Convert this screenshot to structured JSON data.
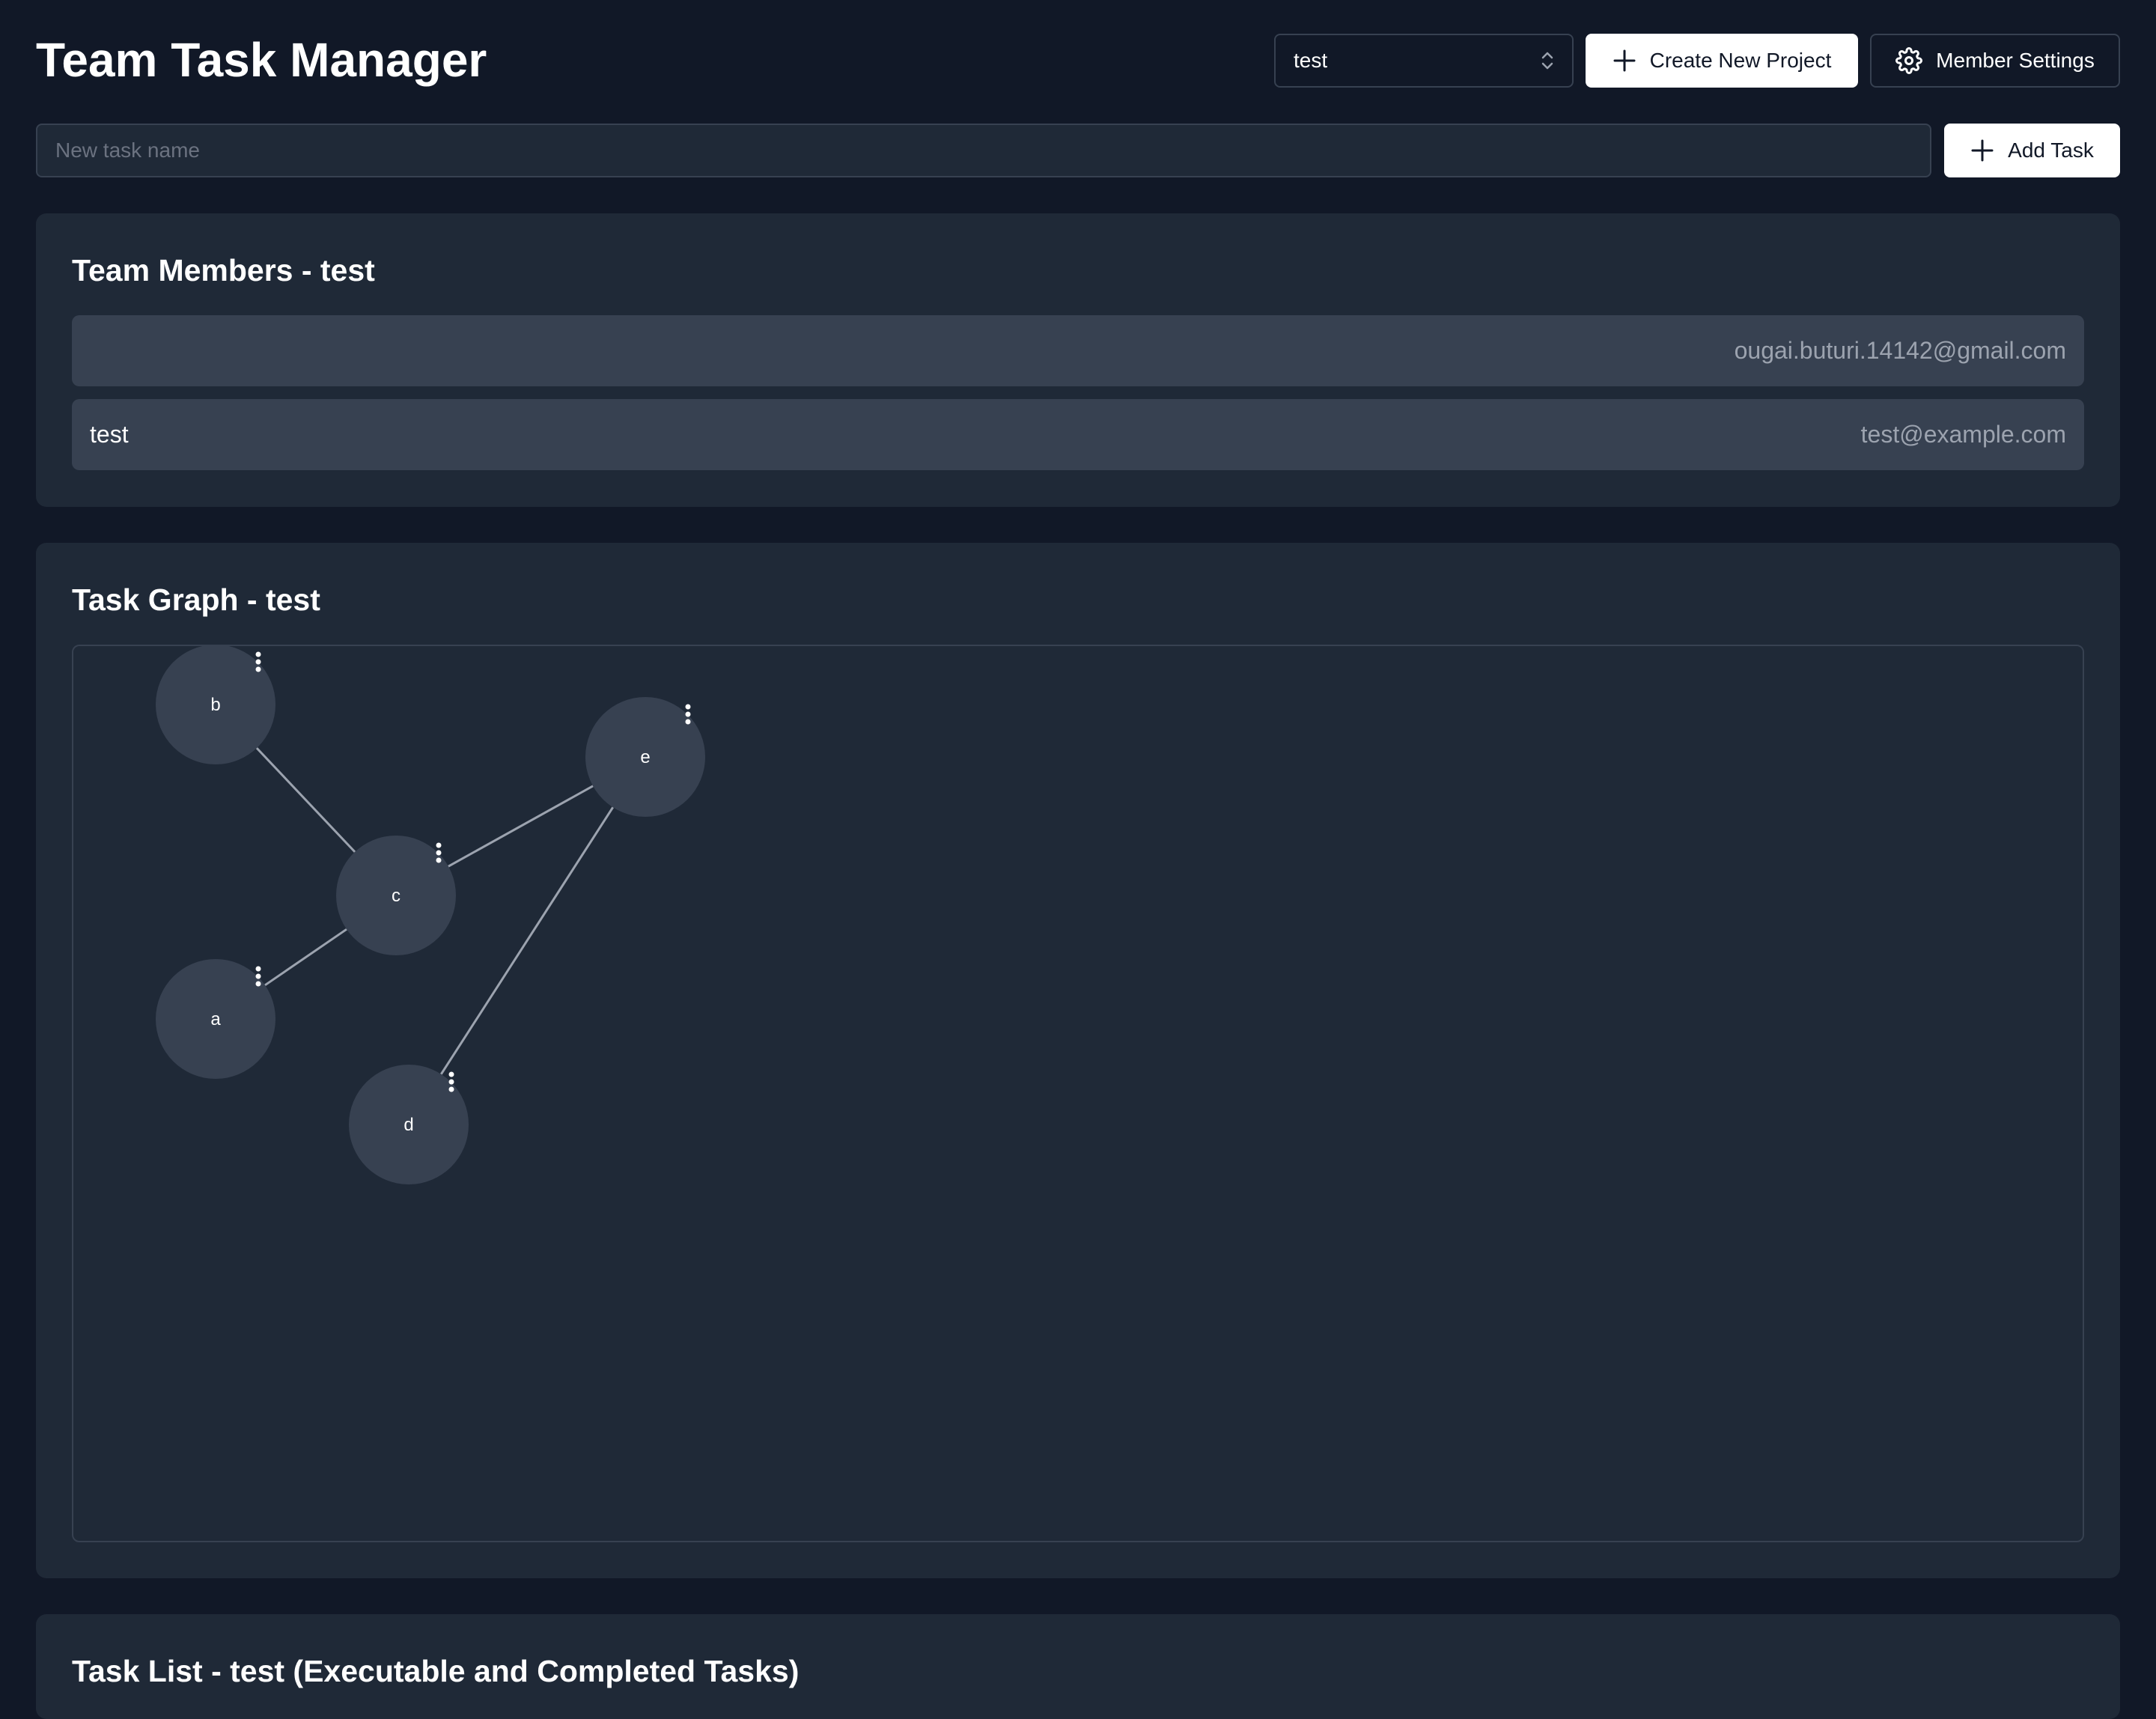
{
  "app": {
    "title": "Team Task Manager"
  },
  "header": {
    "project_select": {
      "value": "test"
    },
    "create_project_label": "Create New Project",
    "member_settings_label": "Member Settings"
  },
  "new_task": {
    "placeholder": "New task name",
    "value": "",
    "add_label": "Add Task"
  },
  "members_panel": {
    "title": "Team Members - test",
    "members": [
      {
        "name": "",
        "email": "ougai.buturi.14142@gmail.com"
      },
      {
        "name": "test",
        "email": "test@example.com"
      }
    ]
  },
  "graph_panel": {
    "title": "Task Graph - test",
    "nodes": [
      {
        "id": "b",
        "label": "b"
      },
      {
        "id": "e",
        "label": "e"
      },
      {
        "id": "c",
        "label": "c"
      },
      {
        "id": "a",
        "label": "a"
      },
      {
        "id": "d",
        "label": "d"
      }
    ],
    "edges": [
      {
        "from": "b",
        "to": "c"
      },
      {
        "from": "c",
        "to": "e"
      },
      {
        "from": "a",
        "to": "c"
      },
      {
        "from": "d",
        "to": "e"
      }
    ]
  },
  "task_list_panel": {
    "title": "Task List - test (Executable and Completed Tasks)"
  },
  "colors": {
    "background": "#111827",
    "panel": "#1f2937",
    "row": "#374151",
    "muted_text": "#9ca3af",
    "edge": "#9ca3af"
  },
  "icons": {
    "create": "plus-icon",
    "settings": "gear-icon",
    "add_task": "plus-icon",
    "select": "chevron-up-down-icon",
    "node_menu": "vertical-ellipsis-icon"
  }
}
